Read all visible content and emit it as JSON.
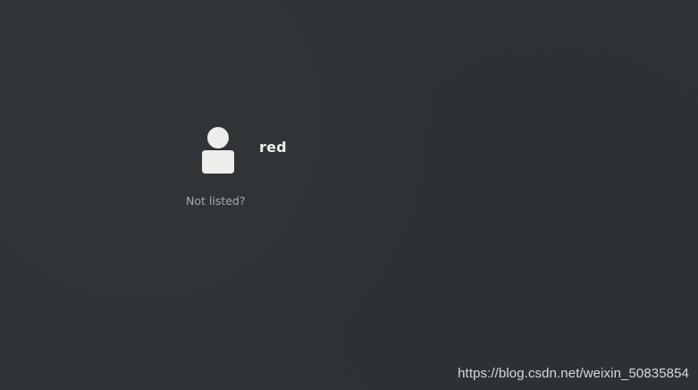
{
  "user_list": {
    "users": [
      {
        "name": "red",
        "avatar_icon": "person-silhouette-icon"
      }
    ],
    "not_listed_label": "Not listed?"
  },
  "watermark": {
    "text": "https://blog.csdn.net/weixin_50835854"
  },
  "colors": {
    "background": "#2e3235",
    "username": "#eeeeec",
    "secondary_text": "#a8aaa8",
    "avatar": "#ededec"
  }
}
